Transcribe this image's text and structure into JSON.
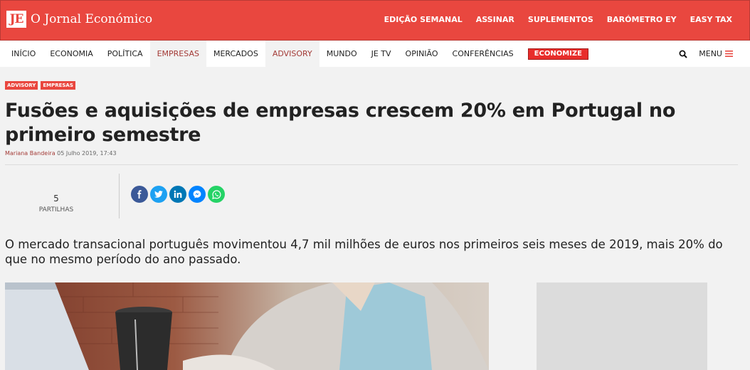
{
  "header": {
    "logo_mark": "JE",
    "logo_text": "O Jornal Económico",
    "links": [
      "EDIÇÃO SEMANAL",
      "ASSINAR",
      "SUPLEMENTOS",
      "BARÓMETRO EY",
      "EASY TAX"
    ]
  },
  "nav": {
    "items": [
      "INÍCIO",
      "ECONOMIA",
      "POLÍTICA",
      "EMPRESAS",
      "MERCADOS",
      "ADVISORY",
      "MUNDO",
      "JE TV",
      "OPINIÃO",
      "CONFERÊNCIAS"
    ],
    "badge": "ECONOMIZE",
    "menu_label": "MENU",
    "search_icon": "search-icon",
    "menu_icon": "hamburger-icon"
  },
  "article": {
    "tags": [
      "ADVISORY",
      "EMPRESAS"
    ],
    "title": "Fusões e aquisições de empresas crescem 20% em Portugal no primeiro semestre",
    "author": "Mariana Bandeira",
    "date": "05 Julho 2019, 17:43",
    "shares_count": "5",
    "shares_label": "PARTILHAS",
    "lead": "O mercado transacional português movimentou 4,7 mil milhões de euros nos primeiros seis meses de 2019, mais 20% do que no mesmo período do ano passado."
  },
  "social": {
    "icons": [
      "facebook-icon",
      "twitter-icon",
      "linkedin-icon",
      "messenger-icon",
      "whatsapp-icon"
    ],
    "colors": {
      "facebook": "#3b5998",
      "twitter": "#1da1f2",
      "linkedin": "#0077b5",
      "messenger": "#0084ff",
      "whatsapp": "#25d366"
    }
  },
  "colors": {
    "brand": "#e9473f",
    "accent_text": "#a33a36",
    "badge": "#e82d2b"
  }
}
